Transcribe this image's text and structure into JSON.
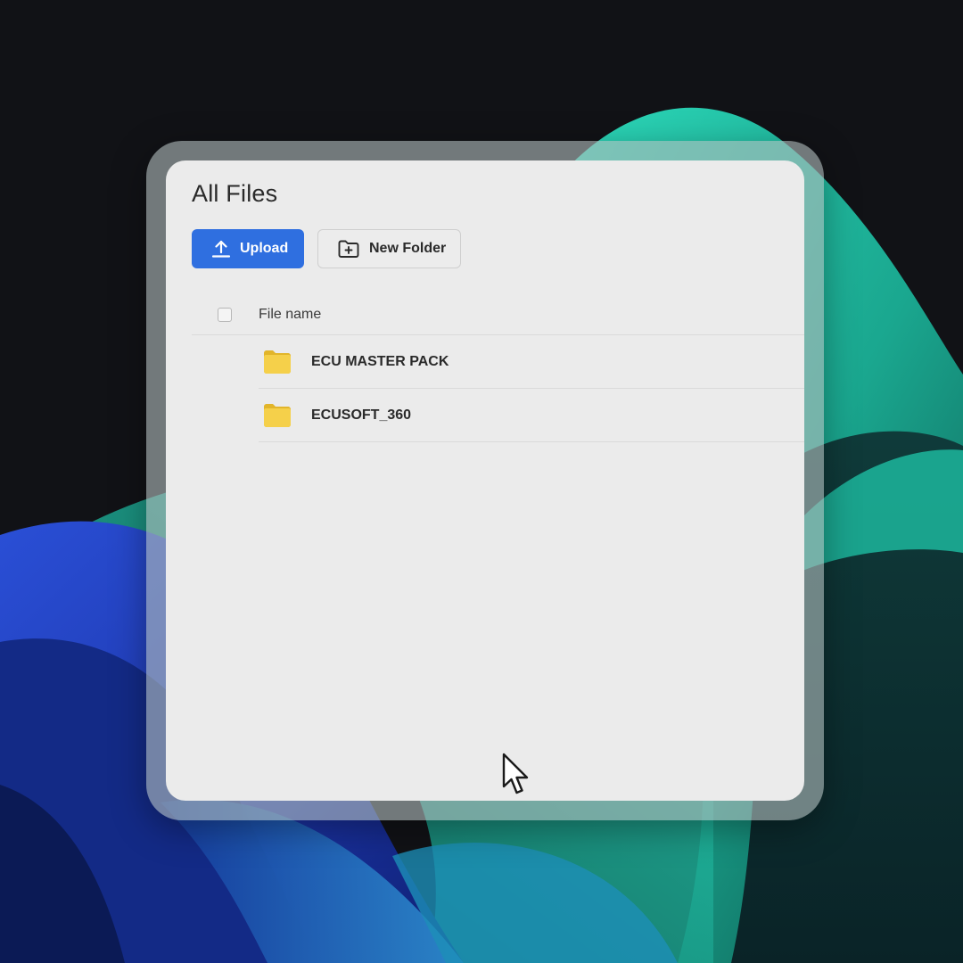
{
  "window": {
    "title": "All Files"
  },
  "toolbar": {
    "upload_label": "Upload",
    "upload_icon": "upload-icon",
    "new_folder_label": "New Folder",
    "new_folder_icon": "folder-plus-icon",
    "upload_color": "#2f6fe0"
  },
  "file_list": {
    "columns": [
      "File name"
    ],
    "items": [
      {
        "name": "ECU MASTER PACK",
        "type": "folder",
        "icon": "folder-icon"
      },
      {
        "name": "ECUSOFT_360",
        "type": "folder",
        "icon": "folder-icon"
      }
    ]
  },
  "colors": {
    "folder": "#f2cc3c",
    "window_bg": "#ebebeb",
    "accent": "#2f6fe0"
  }
}
